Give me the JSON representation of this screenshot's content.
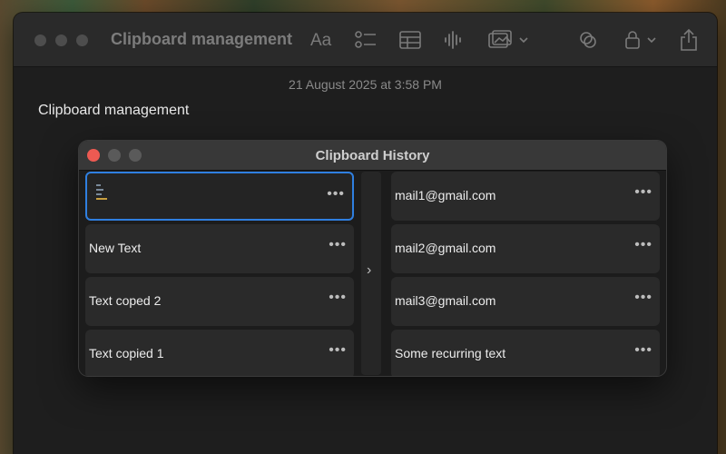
{
  "notes": {
    "toolbar_title": "Clipboard management",
    "font_label": "Aa",
    "date": "21 August 2025 at 3:58 PM",
    "heading": "Clipboard management"
  },
  "clipboard": {
    "title": "Clipboard History",
    "left_items": [
      {
        "label": "",
        "selected": true
      },
      {
        "label": "New Text"
      },
      {
        "label": "Text coped 2"
      },
      {
        "label": "Text copied 1"
      }
    ],
    "right_items": [
      {
        "label": "mail1@gmail.com"
      },
      {
        "label": "mail2@gmail.com"
      },
      {
        "label": "mail3@gmail.com"
      },
      {
        "label": "Some recurring text"
      }
    ],
    "more_glyph": "•••",
    "chevron_glyph": "›"
  },
  "colors": {
    "selection": "#2f7fe0",
    "close": "#ed5a52",
    "inactive": "#5a5a5a"
  }
}
